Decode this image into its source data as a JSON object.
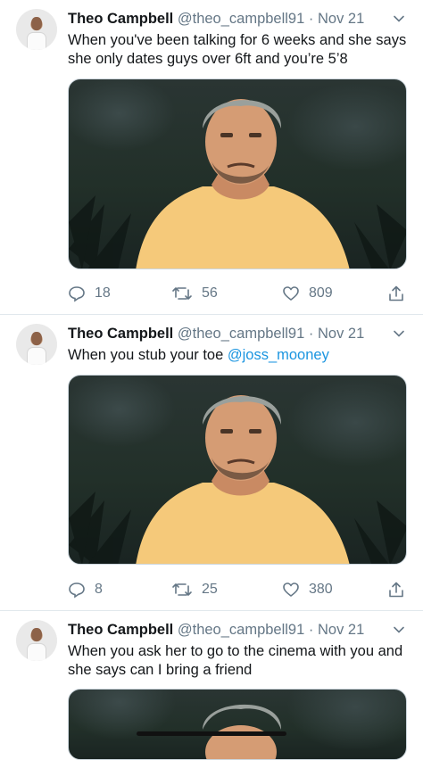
{
  "tweets": [
    {
      "name": "Theo Campbell",
      "handle": "@theo_campbell91",
      "separator": "·",
      "date": "Nov 21",
      "text_lines": [
        "When you've been talking for 6 weeks and she says",
        "she only dates guys over 6ft and you’re 5’8"
      ],
      "replies": "18",
      "retweets": "56",
      "likes": "809"
    },
    {
      "name": "Theo Campbell",
      "handle": "@theo_campbell91",
      "separator": "·",
      "date": "Nov 21",
      "text_plain": "When you stub your toe ",
      "mention": "@joss_mooney",
      "replies": "8",
      "retweets": "25",
      "likes": "380"
    },
    {
      "name": "Theo Campbell",
      "handle": "@theo_campbell91",
      "separator": "·",
      "date": "Nov 21",
      "text_lines": [
        "When you ask her to go to the cinema with you and",
        "she says can I bring a friend"
      ]
    }
  ],
  "icons": {
    "avatar": "avatar",
    "more": "chevron-down-icon",
    "reply": "reply-icon",
    "retweet": "retweet-icon",
    "like": "heart-icon",
    "share": "share-icon"
  },
  "colors": {
    "text": "#14171a",
    "meta": "#657786",
    "mention": "#1b95e0",
    "divider": "#e1e8ed",
    "shirt": "#f5c97a"
  }
}
